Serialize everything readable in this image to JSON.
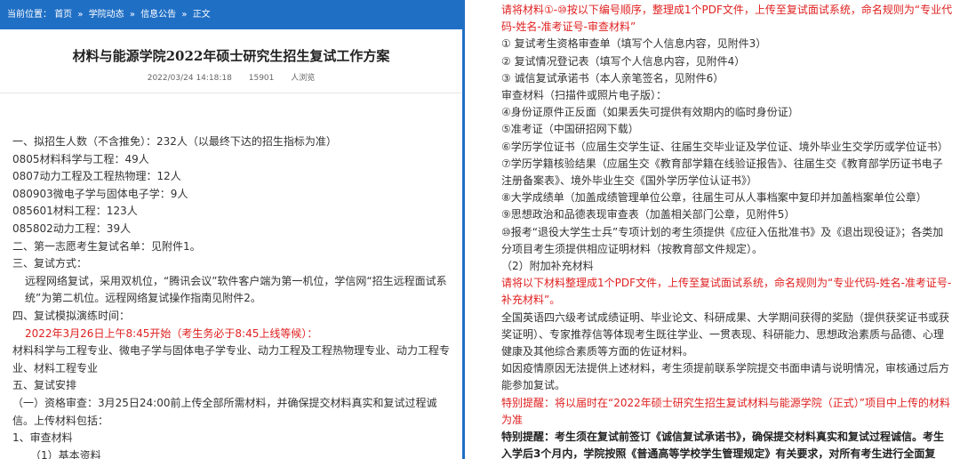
{
  "breadcrumb": {
    "prefix": "当前位置：",
    "items": [
      "首页",
      "学院动态",
      "信息公告",
      "正文"
    ],
    "sep": "»"
  },
  "article": {
    "title": "材料与能源学院2022年硕士研究生招生复试工作方案",
    "date": "2022/03/24 14:18:18",
    "views": "15901",
    "views_label": "人浏览"
  },
  "left_lines": [
    {
      "text": "一、拟招生人数（不含推免）：232人（以最终下达的招生指标为准）",
      "style": ""
    },
    {
      "text": "0805材料科学与工程：49人",
      "style": ""
    },
    {
      "text": "0807动力工程及工程热物理：12人",
      "style": ""
    },
    {
      "text": "080903微电子学与固体电子学：9人",
      "style": ""
    },
    {
      "text": "085601材料工程：123人",
      "style": ""
    },
    {
      "text": "085802动力工程：39人",
      "style": ""
    },
    {
      "text": "二、第一志愿考生复试名单：见附件1。",
      "style": ""
    },
    {
      "text": "三、复试方式：",
      "style": ""
    },
    {
      "text": "远程网络复试，采用双机位，“腾讯会议”软件客户端为第一机位，学信网“招生远程面试系统”为第二机位。远程网络复试操作指南见附件2。",
      "style": "ind"
    },
    {
      "text": "四、复试模拟演练时间：",
      "style": ""
    },
    {
      "text": "2022年3月26日上午8:45开始（考生务必于8:45上线等候）：",
      "style": "ind red"
    },
    {
      "text": "材料科学与工程专业、微电子学与固体电子学专业、动力工程及工程热物理专业、动力工程专业、材料工程专业",
      "style": ""
    },
    {
      "text": "五、复试安排",
      "style": ""
    },
    {
      "text": "（一）资格审查：3月25日24:00前上传全部所需材料，并确保提交材料真实和复试过程诚信。上传材料包括：",
      "style": ""
    },
    {
      "text": "1、审查材料",
      "style": ""
    },
    {
      "text": "（1）基本资料",
      "style": "ind2"
    }
  ],
  "right_lines": [
    {
      "text": "请将材料①-⑩按以下编号顺序，整理成1个PDF文件，上传至复试面试系统，命名规则为“专业代码-姓名-准考证号-审查材料”",
      "style": "ired"
    },
    {
      "text": "① 复试考生资格审查单（填写个人信息内容，见附件3）",
      "style": "i1"
    },
    {
      "text": "② 复试情况登记表（填写个人信息内容，见附件4）",
      "style": "i1"
    },
    {
      "text": "③ 诚信复试承诺书（本人亲笔签名，见附件6）",
      "style": "i1"
    },
    {
      "text": "审查材料（扫描件或照片电子版）：",
      "style": "i1"
    },
    {
      "text": "④身份证原件正反面（如果丢失可提供有效期内的临时身份证）",
      "style": "i1"
    },
    {
      "text": "⑤准考证（中国研招网下载）",
      "style": "i1"
    },
    {
      "text": "⑥学历学位证书（应届生交学生证、往届生交毕业证及学位证、境外毕业生交学历或学位证书）",
      "style": "i1"
    },
    {
      "text": "⑦学历学籍核验结果（应届生交《教育部学籍在线验证报告》、往届生交《教育部学历证书电子注册备案表》、境外毕业生交《国外学历学位认证书》）",
      "style": "i1"
    },
    {
      "text": "⑧大学成绩单（加盖成绩管理单位公章，往届生可从人事档案中复印并加盖档案单位公章）",
      "style": "i1"
    },
    {
      "text": "⑨思想政治和品德表现审查表（加盖相关部门公章，见附件5）",
      "style": "i1"
    },
    {
      "text": "⑩报考“退役大学生士兵”专项计划的考生须提供《应征入伍批准书》及《退出现役证》；各类加分项目考生须提供相应证明材料（按教育部文件规定）。",
      "style": "i1"
    },
    {
      "text": "（2）附加补充材料",
      "style": "i1"
    },
    {
      "text": "请将以下材料整理成1个PDF文件，上传至复试面试系统，命名规则为“专业代码-姓名-准考证号-补充材料”。",
      "style": "ired"
    },
    {
      "text": "全国英语四六级考试成绩证明、毕业论文、科研成果、大学期间获得的奖励（提供获奖证书或获奖证明）、专家推荐信等体现考生既往学业、一贯表现、科研能力、思想政治素质与品德、心理健康及其他综合素质等方面的佐证材料。",
      "style": "i1"
    },
    {
      "text": "如因疫情原因无法提供上述材料，考生须提前联系学院提交书面申请与说明情况，审核通过后方能参加复试。",
      "style": "i1"
    },
    {
      "text": "特别提醒：将以届时在“2022年硕士研究生招生复试材料与能源学院（正式）”项目中上传的材料为准",
      "style": "ired"
    },
    {
      "text": "特别提醒：考生须在复试前签订《诚信复试承诺书》，确保提交材料真实和复试过程诚信。考生入学后3个月内，学院按照《普通高等学校学生管理规定》有关要求，对所有考生进行全面复查。复查不合格的，取消学籍；情节严重的，移交有关部门调查处理。",
      "style": "i1 bold"
    }
  ]
}
